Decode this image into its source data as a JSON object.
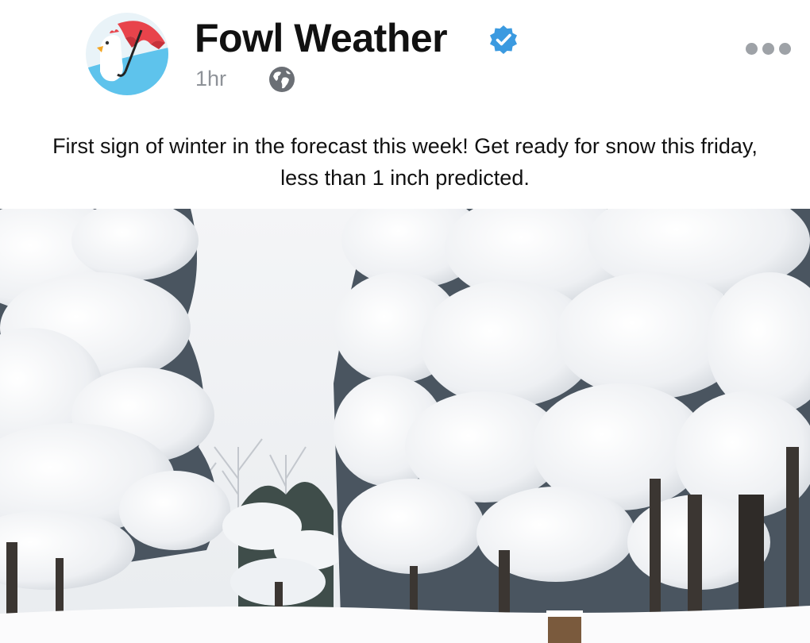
{
  "post": {
    "page_name": "Fowl Weather",
    "timestamp": "1hr",
    "text": "First sign of winter in the forecast this week! Get ready for snow this friday, less than 1 inch predicted."
  },
  "icons": {
    "avatar": "umbrella-chicken-logo",
    "verified": "verified-badge-icon",
    "audience": "globe-icon",
    "menu": "more-options-icon"
  },
  "colors": {
    "verified_blue": "#3b9ae0",
    "umbrella_red": "#e8434b",
    "avatar_sky": "#5ec3ec"
  }
}
